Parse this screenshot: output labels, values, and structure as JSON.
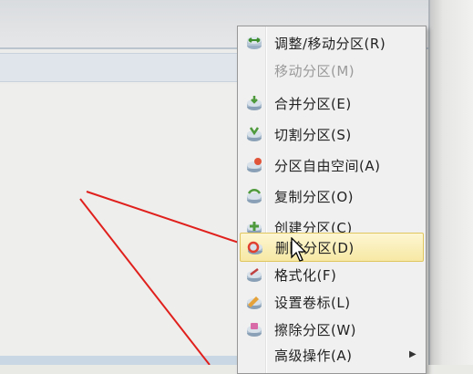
{
  "menu": {
    "items": [
      {
        "label": "调整/移动分区(R)",
        "icon": "resize-partition-icon",
        "disabled": false
      },
      {
        "label": "移动分区(M)",
        "icon": "",
        "disabled": true
      },
      {
        "label": "合并分区(E)",
        "icon": "merge-partition-icon",
        "disabled": false
      },
      {
        "label": "切割分区(S)",
        "icon": "split-partition-icon",
        "disabled": false
      },
      {
        "label": "分区自由空间(A)",
        "icon": "allocate-free-space-icon",
        "disabled": false
      },
      {
        "label": "复制分区(O)",
        "icon": "copy-partition-icon",
        "disabled": false
      },
      {
        "label": "创建分区(C)",
        "icon": "create-partition-icon",
        "disabled": false
      },
      {
        "label": "删除分区(D)",
        "icon": "delete-partition-icon",
        "disabled": false,
        "highlighted": true
      },
      {
        "label": "格式化(F)",
        "icon": "format-partition-icon",
        "disabled": false
      },
      {
        "label": "设置卷标(L)",
        "icon": "set-label-icon",
        "disabled": false
      },
      {
        "label": "擦除分区(W)",
        "icon": "wipe-partition-icon",
        "disabled": false
      },
      {
        "label": "高级操作(A)",
        "icon": "advanced-operations-icon",
        "disabled": false,
        "submenu": true
      }
    ]
  },
  "colors": {
    "highlight_bg": "#f7e8a4",
    "annotation_red": "#e0201c",
    "icon_green": "#4f9a3c"
  }
}
